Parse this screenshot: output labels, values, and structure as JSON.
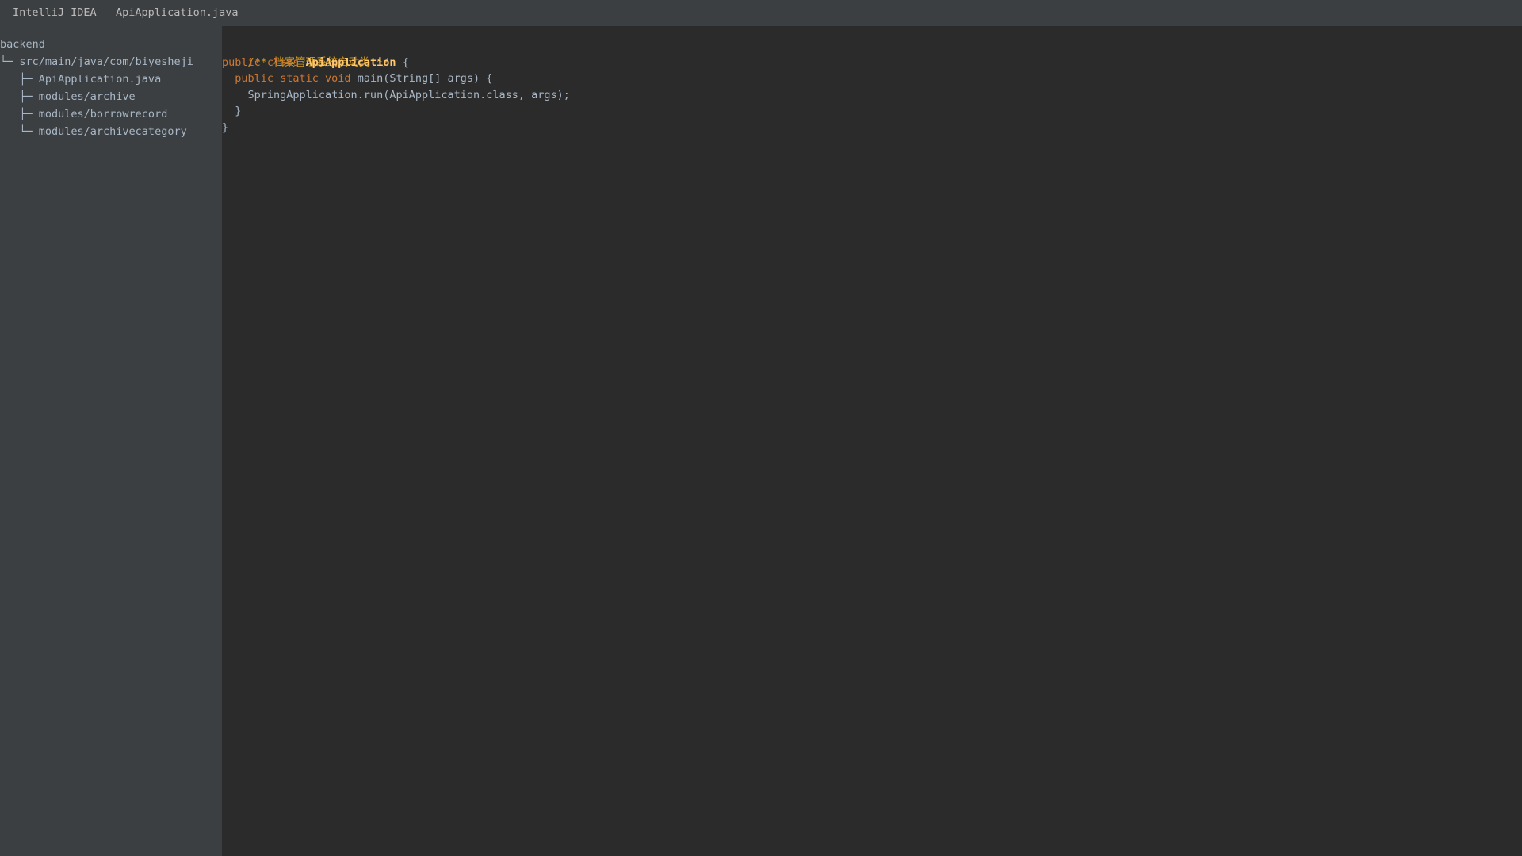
{
  "window": {
    "title": "IntelliJ IDEA — ApiApplication.java"
  },
  "project_tree": {
    "items": [
      {
        "label": "backend"
      },
      {
        "label": "└─ src/main/java/com/biyesheji"
      },
      {
        "label": "   ├─ ApiApplication.java"
      },
      {
        "label": "   ├─ modules/archive"
      },
      {
        "label": "   ├─ modules/borrowrecord"
      },
      {
        "label": "   └─ modules/archivecategory"
      }
    ]
  },
  "editor": {
    "lines": [
      {
        "comment": "/** 档案管理系统启动类 */"
      },
      {
        "kw": "public class ",
        "name": "ApiApplication",
        "rest": " {"
      },
      {
        "indent": "  ",
        "kw": "public static void ",
        "rest": "main(String[] args) {"
      },
      {
        "text": "    SpringApplication.run(ApiApplication.class, args);"
      },
      {
        "text": "  }"
      },
      {
        "text": "}"
      }
    ]
  }
}
